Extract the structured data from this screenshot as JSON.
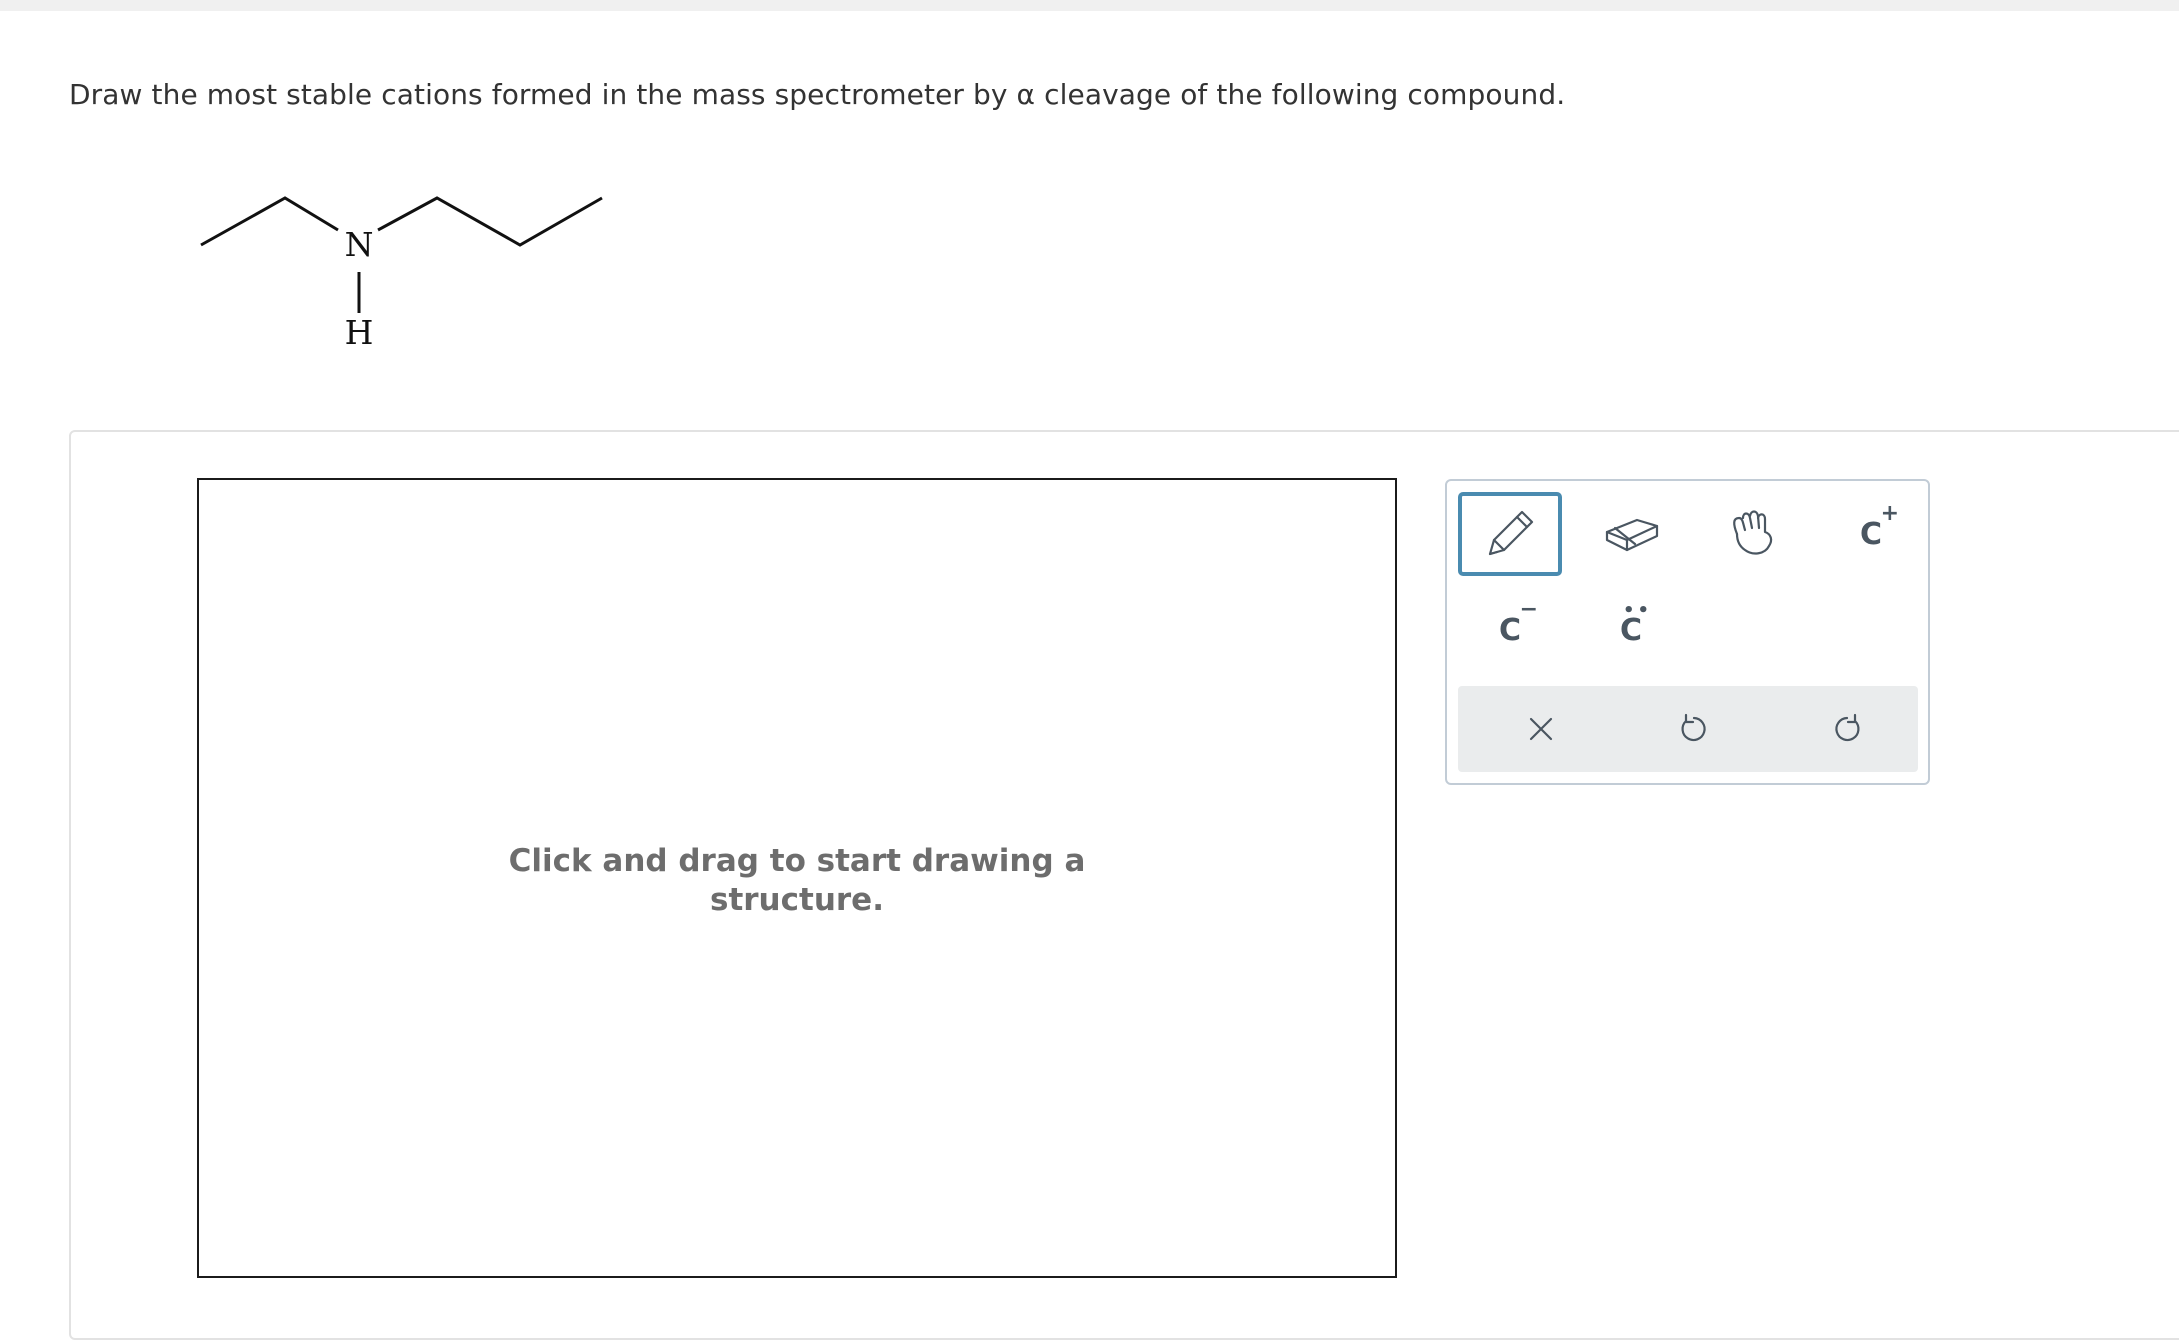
{
  "question": {
    "text": "Draw the most stable cations formed in the mass spectrometer by α cleavage of the following compound."
  },
  "molecule": {
    "atoms": {
      "nitrogen": "N",
      "hydrogen": "H"
    }
  },
  "canvas": {
    "hint_line1": "Click and drag to start drawing a",
    "hint_line2": "structure."
  },
  "toolbar": {
    "tools": [
      {
        "name": "pencil",
        "icon": "pencil-icon",
        "active": true
      },
      {
        "name": "eraser",
        "icon": "eraser-icon",
        "active": false
      },
      {
        "name": "move",
        "icon": "hand-icon",
        "active": false
      },
      {
        "name": "add-positive-charge",
        "label": "C",
        "superscript": "+"
      },
      {
        "name": "add-negative-charge",
        "label": "C",
        "superscript": "−"
      },
      {
        "name": "add-lone-pair",
        "label": "C",
        "dots": "••"
      }
    ],
    "actions": [
      {
        "name": "clear",
        "icon": "close-icon"
      },
      {
        "name": "undo",
        "icon": "undo-icon"
      },
      {
        "name": "redo",
        "icon": "redo-icon"
      }
    ],
    "colors": {
      "active_border": "#4a8bb0",
      "icon": "#4a5661",
      "action_bar_bg": "#eaeced"
    }
  }
}
